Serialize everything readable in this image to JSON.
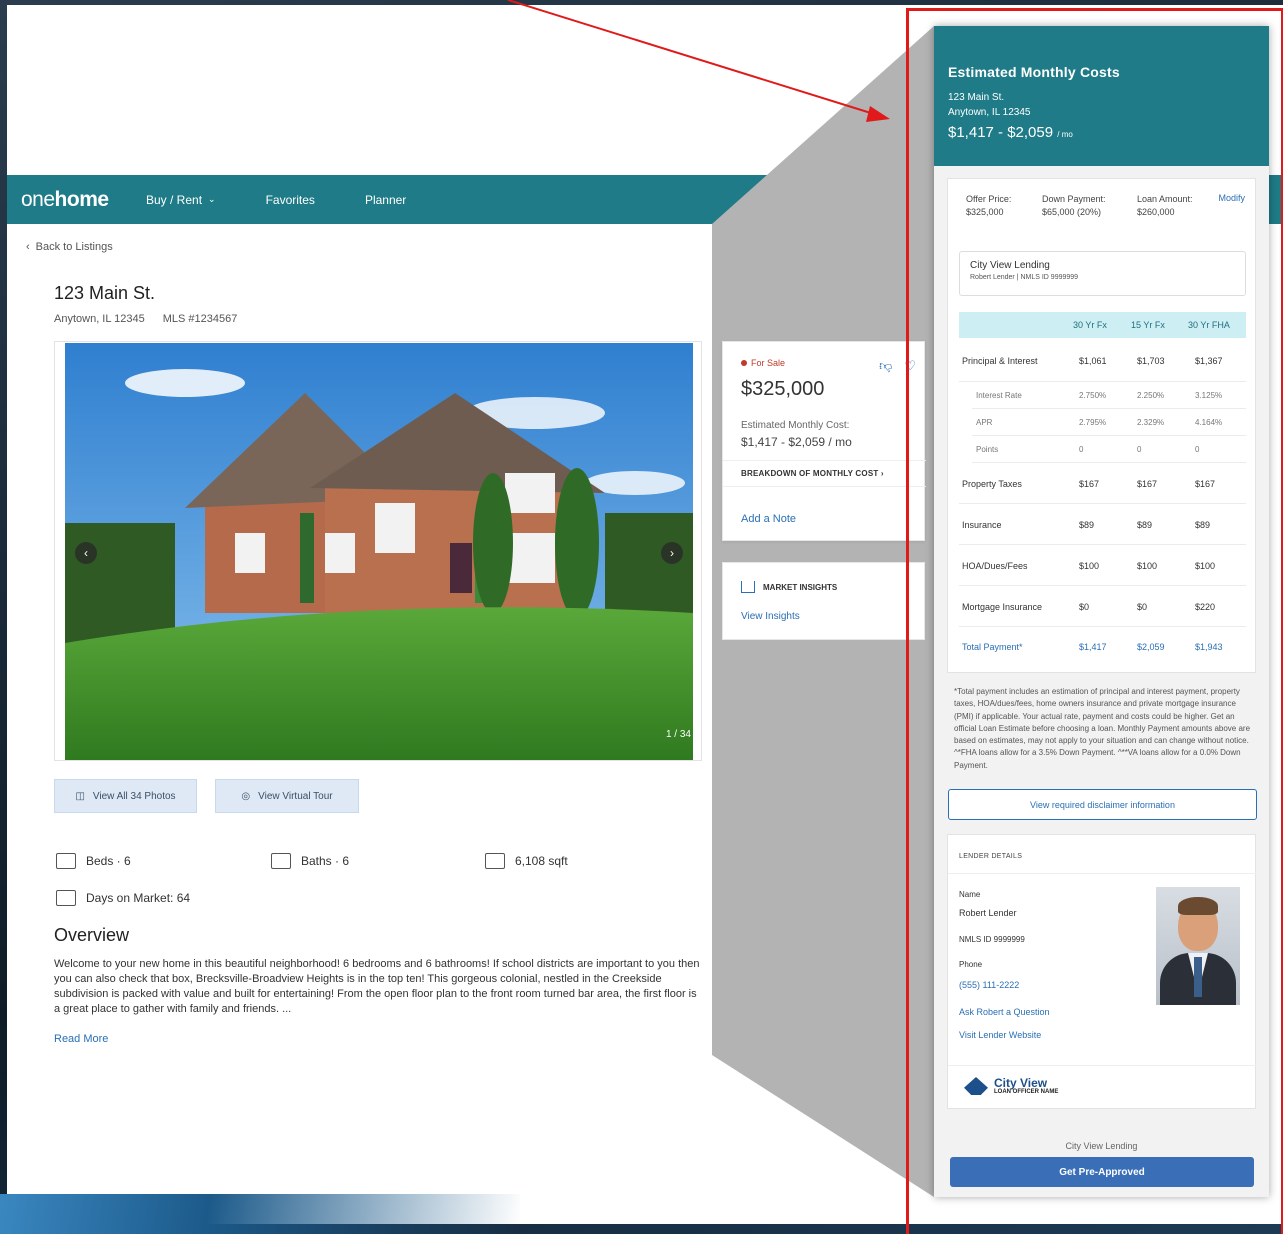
{
  "nav": {
    "logo_pre": "one",
    "logo_bold": "home",
    "items": [
      {
        "label": "Buy / Rent"
      },
      {
        "label": "Favorites"
      },
      {
        "label": "Planner"
      }
    ]
  },
  "listing": {
    "back": "Back to Listings",
    "street": "123 Main St.",
    "city": "Anytown, IL 12345",
    "mls": "MLS #1234567",
    "photo_counter": "1 / 34",
    "view_photos": "View All 34 Photos",
    "virtual_tour": "View Virtual Tour",
    "beds": "Beds · 6",
    "baths": "Baths · 6",
    "sqft": "6,108 sqft",
    "days_on_market": "Days on Market: 64",
    "overview_title": "Overview",
    "overview_text": "Welcome to your new home in this beautiful neighborhood! 6 bedrooms and 6 bathrooms! If school districts are important to you then you can also check that box, Brecksville-Broadview Heights is in the top ten! This gorgeous colonial, nestled in the Creekside subdivision is packed with value and built for entertaining! From the open floor plan to the front room turned bar area, the first floor is a great place to gather with family and friends. ...",
    "read_more": "Read More"
  },
  "price_card": {
    "status": "For Sale",
    "price": "$325,000",
    "emc_label": "Estimated Monthly Cost:",
    "emc_value": "$1,417 - $2,059 / mo",
    "breakdown": "BREAKDOWN OF MONTHLY COST",
    "add_note": "Add a Note"
  },
  "insights_card": {
    "title": "MARKET INSIGHTS",
    "link": "View Insights"
  },
  "panel": {
    "title": "Estimated Monthly Costs",
    "addr1": "123 Main St.",
    "addr2": "Anytown, IL 12345",
    "range": "$1,417 - $2,059",
    "range_unit": "/ mo",
    "offer_label": "Offer Price:",
    "offer_value": "$325,000",
    "down_label": "Down Payment:",
    "down_value": "$65,000 (20%)",
    "loan_label": "Loan Amount:",
    "loan_value": "$260,000",
    "modify": "Modify",
    "lender_name": "City View Lending",
    "lender_sub": "Robert Lender | NMLS ID 9999999",
    "columns": [
      "30 Yr Fx",
      "15 Yr Fx",
      "30 Yr FHA"
    ],
    "rows": [
      {
        "label": "Principal & Interest",
        "v": [
          "$1,061",
          "$1,703",
          "$1,367"
        ]
      },
      {
        "label": "Interest Rate",
        "v": [
          "2.750%",
          "2.250%",
          "3.125%"
        ]
      },
      {
        "label": "APR",
        "v": [
          "2.795%",
          "2.329%",
          "4.164%"
        ]
      },
      {
        "label": "Points",
        "v": [
          "0",
          "0",
          "0"
        ]
      },
      {
        "label": "Property Taxes",
        "v": [
          "$167",
          "$167",
          "$167"
        ]
      },
      {
        "label": "Insurance",
        "v": [
          "$89",
          "$89",
          "$89"
        ]
      },
      {
        "label": "HOA/Dues/Fees",
        "v": [
          "$100",
          "$100",
          "$100"
        ]
      },
      {
        "label": "Mortgage Insurance",
        "v": [
          "$0",
          "$0",
          "$220"
        ]
      },
      {
        "label": "Total Payment*",
        "v": [
          "$1,417",
          "$2,059",
          "$1,943"
        ]
      }
    ],
    "disclaimer": "*Total payment includes an estimation of principal and interest payment, property taxes, HOA/dues/fees, home owners insurance and private mortgage insurance (PMI) if applicable. Your actual rate, payment and costs could be higher. Get an official Loan Estimate before choosing a loan. Monthly Payment amounts above are based on estimates, may not apply to your situation and can change without notice. ^*FHA loans allow for a 3.5% Down Payment. ^**VA loans allow for a 0.0% Down Payment.",
    "disclaimer_btn": "View required disclaimer information",
    "ld_title": "LENDER DETAILS",
    "ld_name_label": "Name",
    "ld_name": "Robert Lender",
    "ld_nmls": "NMLS ID 9999999",
    "ld_phone_label": "Phone",
    "ld_phone": "(555) 111-2222",
    "ld_ask": "Ask Robert a Question",
    "ld_site": "Visit Lender Website",
    "cv_name": "City View",
    "cv_sub": "LOAN OFFICER NAME",
    "footer_lender": "City View Lending",
    "preapprove": "Get Pre-Approved"
  },
  "colors": {
    "teal": "#1e7b87",
    "link": "#2a6fb5",
    "highlight": "#e01a1a",
    "button": "#3a6fb8"
  }
}
